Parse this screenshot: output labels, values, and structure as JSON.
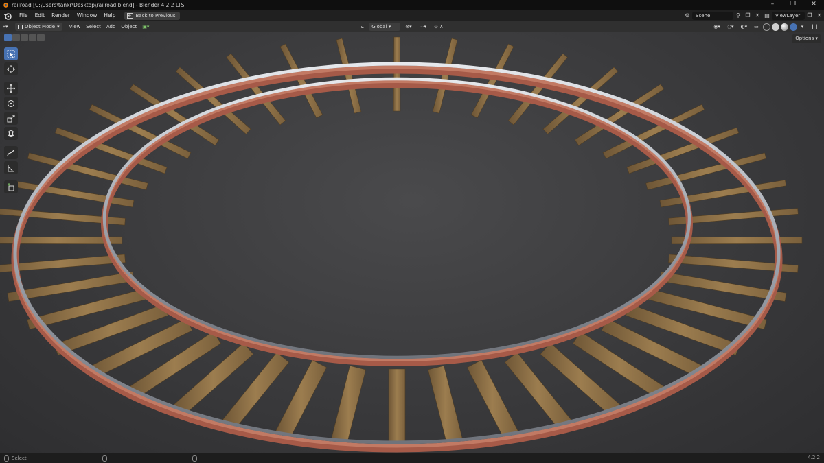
{
  "window": {
    "title": "railroad [C:\\Users\\tankr\\Desktop\\railroad.blend] - Blender 4.2.2 LTS",
    "controls": [
      "–",
      "❐",
      "✕"
    ]
  },
  "menu": {
    "items": [
      "File",
      "Edit",
      "Render",
      "Window",
      "Help"
    ],
    "back_button": "Back to Previous",
    "scene": "Scene",
    "view_layer": "ViewLayer"
  },
  "header": {
    "mode": "Object Mode",
    "menus": [
      "View",
      "Select",
      "Add",
      "Object"
    ],
    "transform_orientation": "Global"
  },
  "viewport": {
    "options_label": "Options",
    "tools": [
      "select-box-icon",
      "cursor-icon",
      "move-icon",
      "rotate-icon",
      "scale-icon",
      "transform-icon",
      "annotate-icon",
      "measure-icon",
      "add-cube-icon"
    ]
  },
  "status": {
    "left": "Select",
    "version": "4.2.2"
  },
  "colors": {
    "accent": "#4772b3",
    "rail_base": "#b86b58",
    "rail_top": "#c9ccd2",
    "tie": "#8a6e45"
  }
}
